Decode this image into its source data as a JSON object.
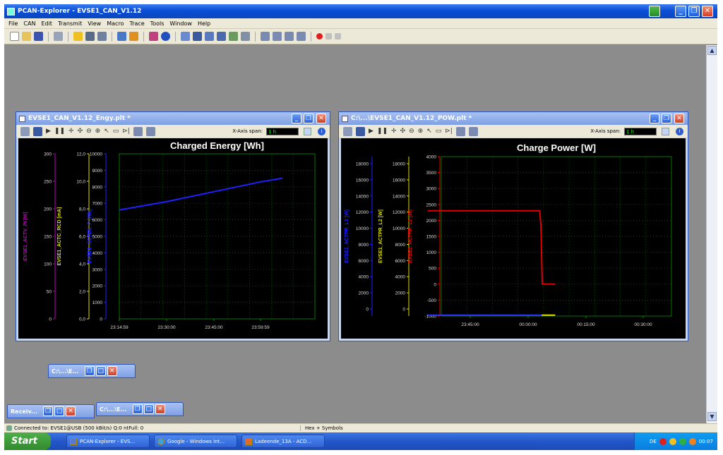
{
  "app": {
    "title": "PCAN-Explorer - EVSE1_CAN_V1.12",
    "menu": [
      "File",
      "CAN",
      "Edit",
      "Transmit",
      "View",
      "Macro",
      "Trace",
      "Tools",
      "Window",
      "Help"
    ]
  },
  "window_buttons": {
    "minimize": "_",
    "restore": "❐",
    "close": "✕"
  },
  "energy_window": {
    "title": "EVSE1_CAN_V1.12_Engy.plt *",
    "span_label": "X-Axis span:",
    "span_value": "1 h",
    "chart_title": "Charged Energy [Wh]"
  },
  "power_window": {
    "title": "C:\\...\\EVSE1_CAN_V1.12_POW.plt *",
    "span_label": "X-Axis span:",
    "span_value": "1 h",
    "chart_title": "Charge Power [W]"
  },
  "minimized": [
    {
      "label": "C:\\...\\E..."
    },
    {
      "label": "Receiv..."
    },
    {
      "label": "C:\\...\\E..."
    }
  ],
  "status": {
    "connection": "Connected to: EVSE1@USB (500 kBit/s)  Q:0 ntFull: 0",
    "mode": "Hex + Symbols"
  },
  "taskbar": {
    "start": "Start",
    "tasks": [
      "PCAN-Explorer - EVS...",
      "Google - Windows Int...",
      "Ladeende_13A - ACD..."
    ],
    "lang": "DE",
    "clock": "00:07"
  },
  "chart_data": [
    {
      "type": "line",
      "title": "Charged Energy [Wh]",
      "x_ticks": [
        "23:14:59",
        "23:30:00",
        "23:45:00",
        "23:59:59"
      ],
      "axes": [
        {
          "label": "EVSE1_ACTV_PI [W]",
          "color": "#c000c0",
          "ticks": [
            "300",
            "250",
            "200",
            "150",
            "100",
            "50",
            "0"
          ],
          "ylim": [
            0,
            300
          ]
        },
        {
          "label": "EVSE1_ACTC_RCD [mA]",
          "color": "#e0e000",
          "ticks": [
            "12,0",
            "10,0",
            "8,0",
            "6,0",
            "4,0",
            "2,0",
            "0,0"
          ],
          "ylim": [
            0,
            12
          ]
        },
        {
          "label": "EVSE1_ACTEN_P [Wh]",
          "color": "#2020ff",
          "ticks": [
            "10000",
            "9000",
            "8000",
            "7000",
            "6000",
            "5000",
            "4000",
            "3000",
            "2000",
            "1000",
            "0"
          ],
          "ylim": [
            0,
            10000
          ]
        }
      ],
      "series": [
        {
          "name": "EVSE1_ACTEN_P [Wh]",
          "color": "#2020ff",
          "x": [
            "23:14:59",
            "23:30:00",
            "23:45:00",
            "23:59:59",
            "00:07:00"
          ],
          "y": [
            6600,
            7100,
            7700,
            8300,
            8520
          ]
        }
      ],
      "grid": true
    },
    {
      "type": "line",
      "title": "Charge Power [W]",
      "x_ticks": [
        "23:45:00",
        "00:00:00",
        "00:15:00",
        "00:30:00"
      ],
      "axes": [
        {
          "label": "EVSE1_ACTPR_L3 [W]",
          "color": "#2020ff",
          "ticks": [
            "18000",
            "16000",
            "14000",
            "12000",
            "10000",
            "8000",
            "6000",
            "4000",
            "2000",
            "0"
          ],
          "ylim": [
            -800,
            18000
          ]
        },
        {
          "label": "EVSE1_ACTPR_L2 [W]",
          "color": "#e0e000",
          "ticks": [
            "18000",
            "16000",
            "14000",
            "12000",
            "10000",
            "8000",
            "6000",
            "4000",
            "2000",
            "0"
          ],
          "ylim": [
            -800,
            18000
          ]
        },
        {
          "label": "EVSE1_ACTPR_L1 [W]",
          "color": "#e00000",
          "ticks": [
            "4000",
            "3500",
            "3000",
            "2500",
            "2000",
            "1500",
            "1000",
            "500",
            "0",
            "-500",
            "-1000"
          ],
          "ylim": [
            -1000,
            4000
          ]
        }
      ],
      "series": [
        {
          "name": "EVSE1_ACTPR_L1 [W]",
          "color": "#e00000",
          "x": [
            "23:34:00",
            "00:03:00",
            "00:03:20",
            "00:03:40",
            "00:07:00"
          ],
          "y": [
            2300,
            2300,
            1800,
            0,
            0
          ]
        },
        {
          "name": "EVSE1_ACTPR_L3 [W]",
          "color": "#3030ff",
          "x": [
            "23:34:00",
            "00:03:30"
          ],
          "y": [
            -700,
            -700
          ]
        },
        {
          "name": "EVSE1_ACTPR_L2 [W]",
          "color": "#e0e000",
          "x": [
            "00:03:30",
            "00:07:00"
          ],
          "y": [
            -700,
            -700
          ]
        }
      ],
      "grid": true
    }
  ]
}
